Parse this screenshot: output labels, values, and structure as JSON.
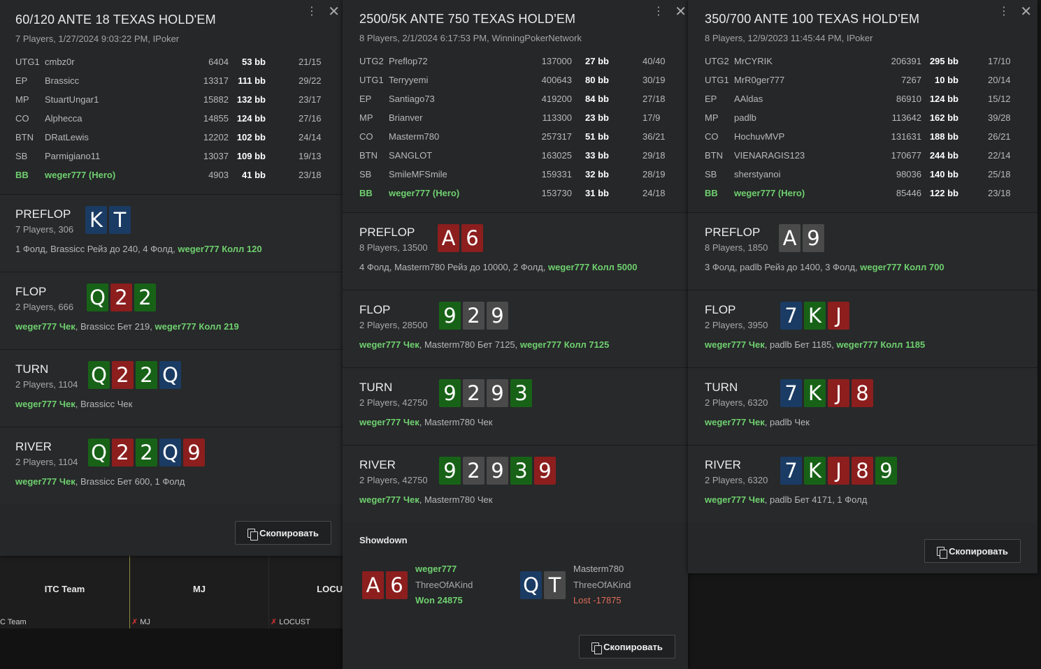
{
  "background_app": {
    "tiles": [
      {
        "name": "ITC Team",
        "sub": "C Team",
        "active": true
      },
      {
        "name": "MJ",
        "sub": "MJ",
        "active": false
      },
      {
        "name": "LOCU",
        "sub": "LOCUST",
        "active": false
      }
    ]
  },
  "copy_label": "Скопировать",
  "colors": {
    "hero": "#6fd06f",
    "clubs": "#186218",
    "diamonds": "#1a3b63",
    "hearts": "#8c1e1e",
    "spades": "#4a4a4a"
  },
  "hands": [
    {
      "title": "60/120 ANTE 18 TEXAS HOLD'EM",
      "meta": "7 Players, 1/27/2024 9:03:22 PM, IPoker",
      "players": [
        {
          "pos": "UTG1",
          "name": "cmbz0r",
          "stack": "6404",
          "bb": "53 bb",
          "ratio": "21/15",
          "hero": false
        },
        {
          "pos": "EP",
          "name": "Brassicc",
          "stack": "13317",
          "bb": "111 bb",
          "ratio": "29/22",
          "hero": false
        },
        {
          "pos": "MP",
          "name": "StuartUngar1",
          "stack": "15882",
          "bb": "132 bb",
          "ratio": "23/17",
          "hero": false
        },
        {
          "pos": "CO",
          "name": "Alphecca",
          "stack": "14855",
          "bb": "124 bb",
          "ratio": "27/16",
          "hero": false
        },
        {
          "pos": "BTN",
          "name": "DRatLewis",
          "stack": "12202",
          "bb": "102 bb",
          "ratio": "24/14",
          "hero": false
        },
        {
          "pos": "SB",
          "name": "Parmigiano11",
          "stack": "13037",
          "bb": "109 bb",
          "ratio": "19/13",
          "hero": false
        },
        {
          "pos": "BB",
          "name": "weger777 (Hero)",
          "stack": "4903",
          "bb": "41 bb",
          "ratio": "23/18",
          "hero": true
        }
      ],
      "streets": [
        {
          "name": "PREFLOP",
          "info": "7 Players, 306",
          "cards": [
            {
              "r": "K",
              "s": "d"
            },
            {
              "r": "T",
              "s": "d"
            }
          ],
          "actions": [
            {
              "t": "1 Фолд, Brassicc Рейз до 240, 4 Фолд, ",
              "h": false
            },
            {
              "t": "weger777 Колл 120",
              "h": true
            }
          ]
        },
        {
          "name": "FLOP",
          "info": "2 Players, 666",
          "cards": [
            {
              "r": "Q",
              "s": "c"
            },
            {
              "r": "2",
              "s": "h"
            },
            {
              "r": "2",
              "s": "c"
            }
          ],
          "actions": [
            {
              "t": "weger777 Чек",
              "h": true
            },
            {
              "t": ", Brassicc Бет 219, ",
              "h": false
            },
            {
              "t": "weger777 Колл 219",
              "h": true
            }
          ]
        },
        {
          "name": "TURN",
          "info": "2 Players, 1104",
          "cards": [
            {
              "r": "Q",
              "s": "c"
            },
            {
              "r": "2",
              "s": "h"
            },
            {
              "r": "2",
              "s": "c"
            },
            {
              "r": "Q",
              "s": "d"
            }
          ],
          "actions": [
            {
              "t": "weger777 Чек",
              "h": true
            },
            {
              "t": ", Brassicc Чек",
              "h": false
            }
          ]
        },
        {
          "name": "RIVER",
          "info": "2 Players, 1104",
          "cards": [
            {
              "r": "Q",
              "s": "c"
            },
            {
              "r": "2",
              "s": "h"
            },
            {
              "r": "2",
              "s": "c"
            },
            {
              "r": "Q",
              "s": "d"
            },
            {
              "r": "9",
              "s": "h"
            }
          ],
          "actions": [
            {
              "t": "weger777 Чек",
              "h": true
            },
            {
              "t": ", Brassicc Бет 600, 1 Фолд",
              "h": false
            }
          ]
        }
      ]
    },
    {
      "title": "2500/5K ANTE 750 TEXAS HOLD'EM",
      "meta": "8 Players, 2/1/2024 6:17:53 PM, WinningPokerNetwork",
      "players": [
        {
          "pos": "UTG2",
          "name": "Preflop72",
          "stack": "137000",
          "bb": "27 bb",
          "ratio": "40/40",
          "hero": false
        },
        {
          "pos": "UTG1",
          "name": "Terryyemi",
          "stack": "400643",
          "bb": "80 bb",
          "ratio": "30/19",
          "hero": false
        },
        {
          "pos": "EP",
          "name": "Santiago73",
          "stack": "419200",
          "bb": "84 bb",
          "ratio": "27/18",
          "hero": false
        },
        {
          "pos": "MP",
          "name": "Brianver",
          "stack": "113300",
          "bb": "23 bb",
          "ratio": "17/9",
          "hero": false
        },
        {
          "pos": "CO",
          "name": "Masterm780",
          "stack": "257317",
          "bb": "51 bb",
          "ratio": "36/21",
          "hero": false
        },
        {
          "pos": "BTN",
          "name": "SANGLOT",
          "stack": "163025",
          "bb": "33 bb",
          "ratio": "29/18",
          "hero": false
        },
        {
          "pos": "SB",
          "name": "SmileMFSmile",
          "stack": "159331",
          "bb": "32 bb",
          "ratio": "28/19",
          "hero": false
        },
        {
          "pos": "BB",
          "name": "weger777 (Hero)",
          "stack": "153730",
          "bb": "31 bb",
          "ratio": "24/18",
          "hero": true
        }
      ],
      "streets": [
        {
          "name": "PREFLOP",
          "info": "8 Players, 13500",
          "cards": [
            {
              "r": "A",
              "s": "h"
            },
            {
              "r": "6",
              "s": "h"
            }
          ],
          "actions": [
            {
              "t": "4 Фолд, Masterm780 Рейз до 10000, 2 Фолд, ",
              "h": false
            },
            {
              "t": "weger777 Колл 5000",
              "h": true
            }
          ]
        },
        {
          "name": "FLOP",
          "info": "2 Players, 28500",
          "cards": [
            {
              "r": "9",
              "s": "c"
            },
            {
              "r": "2",
              "s": "s"
            },
            {
              "r": "9",
              "s": "s"
            }
          ],
          "actions": [
            {
              "t": "weger777 Чек",
              "h": true
            },
            {
              "t": ", Masterm780 Бет 7125, ",
              "h": false
            },
            {
              "t": "weger777 Колл 7125",
              "h": true
            }
          ]
        },
        {
          "name": "TURN",
          "info": "2 Players, 42750",
          "cards": [
            {
              "r": "9",
              "s": "c"
            },
            {
              "r": "2",
              "s": "s"
            },
            {
              "r": "9",
              "s": "s"
            },
            {
              "r": "3",
              "s": "c"
            }
          ],
          "actions": [
            {
              "t": "weger777 Чек",
              "h": true
            },
            {
              "t": ", Masterm780 Чек",
              "h": false
            }
          ]
        },
        {
          "name": "RIVER",
          "info": "2 Players, 42750",
          "cards": [
            {
              "r": "9",
              "s": "c"
            },
            {
              "r": "2",
              "s": "s"
            },
            {
              "r": "9",
              "s": "s"
            },
            {
              "r": "3",
              "s": "c"
            },
            {
              "r": "9",
              "s": "h"
            }
          ],
          "actions": [
            {
              "t": "weger777 Чек",
              "h": true
            },
            {
              "t": ", Masterm780 Чек",
              "h": false
            }
          ]
        }
      ],
      "showdown": {
        "label": "Showdown",
        "players": [
          {
            "name": "weger777",
            "hand": "ThreeOfAKind",
            "result": "Won 24875",
            "won": true,
            "hero": true,
            "cards": [
              {
                "r": "A",
                "s": "h"
              },
              {
                "r": "6",
                "s": "h"
              }
            ]
          },
          {
            "name": "Masterm780",
            "hand": "ThreeOfAKind",
            "result": "Lost -17875",
            "won": false,
            "hero": false,
            "cards": [
              {
                "r": "Q",
                "s": "d"
              },
              {
                "r": "T",
                "s": "s"
              }
            ]
          }
        ]
      }
    },
    {
      "title": "350/700 ANTE 100 TEXAS HOLD'EM",
      "meta": "8 Players, 12/9/2023 11:45:44 PM, IPoker",
      "players": [
        {
          "pos": "UTG2",
          "name": "MrCYRIK",
          "stack": "206391",
          "bb": "295 bb",
          "ratio": "17/10",
          "hero": false
        },
        {
          "pos": "UTG1",
          "name": "MrR0ger777",
          "stack": "7267",
          "bb": "10 bb",
          "ratio": "20/14",
          "hero": false
        },
        {
          "pos": "EP",
          "name": "AAldas",
          "stack": "86910",
          "bb": "124 bb",
          "ratio": "15/12",
          "hero": false
        },
        {
          "pos": "MP",
          "name": "padlb",
          "stack": "113642",
          "bb": "162 bb",
          "ratio": "39/28",
          "hero": false
        },
        {
          "pos": "CO",
          "name": "HochuvMVP",
          "stack": "131631",
          "bb": "188 bb",
          "ratio": "26/21",
          "hero": false
        },
        {
          "pos": "BTN",
          "name": "VIENARAGIS123",
          "stack": "170677",
          "bb": "244 bb",
          "ratio": "22/14",
          "hero": false
        },
        {
          "pos": "SB",
          "name": "sherstyanoi",
          "stack": "98036",
          "bb": "140 bb",
          "ratio": "25/18",
          "hero": false
        },
        {
          "pos": "BB",
          "name": "weger777 (Hero)",
          "stack": "85446",
          "bb": "122 bb",
          "ratio": "23/18",
          "hero": true
        }
      ],
      "streets": [
        {
          "name": "PREFLOP",
          "info": "8 Players, 1850",
          "cards": [
            {
              "r": "A",
              "s": "s"
            },
            {
              "r": "9",
              "s": "s"
            }
          ],
          "actions": [
            {
              "t": "3 Фолд, padlb Рейз до 1400, 3 Фолд, ",
              "h": false
            },
            {
              "t": "weger777 Колл 700",
              "h": true
            }
          ]
        },
        {
          "name": "FLOP",
          "info": "2 Players, 3950",
          "cards": [
            {
              "r": "7",
              "s": "d"
            },
            {
              "r": "K",
              "s": "c"
            },
            {
              "r": "J",
              "s": "h"
            }
          ],
          "actions": [
            {
              "t": "weger777 Чек",
              "h": true
            },
            {
              "t": ", padlb Бет 1185, ",
              "h": false
            },
            {
              "t": "weger777 Колл 1185",
              "h": true
            }
          ]
        },
        {
          "name": "TURN",
          "info": "2 Players, 6320",
          "cards": [
            {
              "r": "7",
              "s": "d"
            },
            {
              "r": "K",
              "s": "c"
            },
            {
              "r": "J",
              "s": "h"
            },
            {
              "r": "8",
              "s": "h"
            }
          ],
          "actions": [
            {
              "t": "weger777 Чек",
              "h": true
            },
            {
              "t": ", padlb Чек",
              "h": false
            }
          ]
        },
        {
          "name": "RIVER",
          "info": "2 Players, 6320",
          "cards": [
            {
              "r": "7",
              "s": "d"
            },
            {
              "r": "K",
              "s": "c"
            },
            {
              "r": "J",
              "s": "h"
            },
            {
              "r": "8",
              "s": "h"
            },
            {
              "r": "9",
              "s": "c"
            }
          ],
          "actions": [
            {
              "t": "weger777 Чек",
              "h": true
            },
            {
              "t": ", padlb Бет 4171, 1 Фолд",
              "h": false
            }
          ]
        }
      ]
    }
  ]
}
